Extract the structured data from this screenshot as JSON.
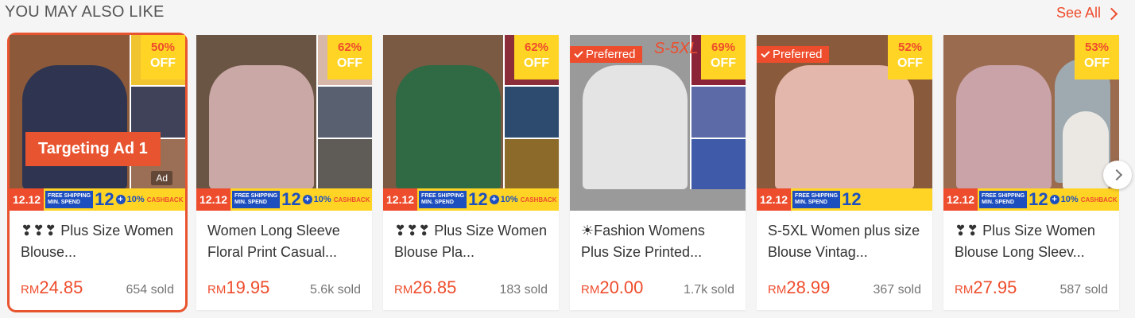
{
  "section": {
    "title": "YOU MAY ALSO LIKE",
    "see_all": "See All"
  },
  "ad_label": "Targeting Ad 1",
  "promo": {
    "date": "12.12",
    "free_shipping": "FREE SHIPPING",
    "min_spend": "MIN. SPEND",
    "big": "12",
    "cashback": "10%",
    "cashback_word": "CASHBACK"
  },
  "products": [
    {
      "name": "❣❣❣ Plus Size Women Blouse...",
      "currency": "RM",
      "price": "24.85",
      "sold": "654 sold",
      "discount": "50%",
      "off": "OFF",
      "badge": "Ad",
      "colors": {
        "main": "#2f3550",
        "t1": "#f0c430",
        "t2": "#40425a",
        "t3": "#9a6f55",
        "bg": "#8c5a3a"
      }
    },
    {
      "name": "Women Long Sleeve Floral Print Casual...",
      "currency": "RM",
      "price": "19.95",
      "sold": "5.6k sold",
      "discount": "62%",
      "off": "OFF",
      "colors": {
        "main": "#c9a8a6",
        "t1": "#d7b7a8",
        "t2": "#59606f",
        "t3": "#5f5c58",
        "bg": "#6a5443"
      }
    },
    {
      "name": "❣❣❣ Plus Size Women Blouse Pla...",
      "currency": "RM",
      "price": "26.85",
      "sold": "183 sold",
      "discount": "62%",
      "off": "OFF",
      "colors": {
        "main": "#2f6a45",
        "t1": "#8c2d3a",
        "t2": "#2c4b6f",
        "t3": "#8b6a2a",
        "bg": "#7a5a43"
      }
    },
    {
      "name": "☀Fashion Womens Plus Size Printed...",
      "currency": "RM",
      "price": "20.00",
      "sold": "1.7k sold",
      "discount": "69%",
      "off": "OFF",
      "preferred": "Preferred",
      "size_overlay": "S-5XL",
      "colors": {
        "main": "#e4e4e4",
        "t1": "#8b2436",
        "t2": "#5d6aa8",
        "t3": "#3f5aa8",
        "bg": "#9a9a9a"
      }
    },
    {
      "name": "S-5XL Women plus size Blouse Vintag...",
      "currency": "RM",
      "price": "28.99",
      "sold": "367 sold",
      "discount": "52%",
      "off": "OFF",
      "preferred": "Preferred",
      "colors": {
        "main": "#e3b7ac",
        "t1": "#e3b7ac",
        "t2": "#e3b7ac",
        "t3": "#e3b7ac",
        "bg": "#8a5a3c"
      }
    },
    {
      "name": "❣❣ Plus Size Women Blouse Long Sleev...",
      "currency": "RM",
      "price": "27.95",
      "sold": "587 sold",
      "discount": "53%",
      "off": "OFF",
      "colors": {
        "main": "#c9a3a8",
        "t1": "#9eaab0",
        "t2": "#ebe8e4",
        "t3": "#c9a3a8",
        "bg": "#9a6b4f"
      }
    }
  ]
}
